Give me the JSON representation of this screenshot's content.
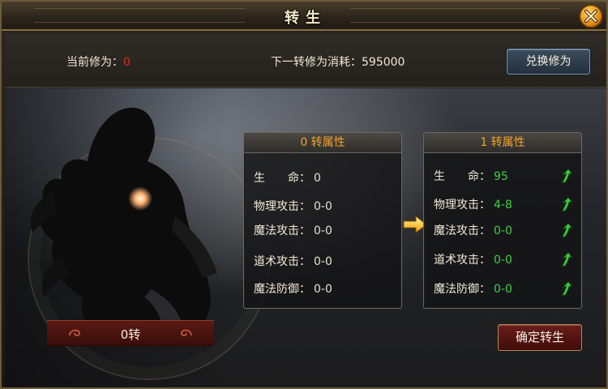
{
  "window": {
    "title": "转生",
    "close_icon": "close-icon"
  },
  "header": {
    "current_label": "当前修为：",
    "current_value": "0",
    "next_cost_label": "下一转修为消耗：",
    "next_cost_value": "595000",
    "exchange_button": "兑换修为"
  },
  "character": {
    "rebirth_level": "0转"
  },
  "current_panel": {
    "title": "0 转属性",
    "stats": [
      {
        "label": "生　　命：",
        "value": "0"
      },
      {
        "label": "物理攻击：",
        "value": "0-0"
      },
      {
        "label": "魔法攻击：",
        "value": "0-0"
      },
      {
        "label": "道术攻击：",
        "value": "0-0"
      },
      {
        "label": "魔法防御：",
        "value": "0-0"
      }
    ]
  },
  "next_panel": {
    "title": "1 转属性",
    "stats": [
      {
        "label": "生　　命：",
        "value": "95"
      },
      {
        "label": "物理攻击：",
        "value": "4-8"
      },
      {
        "label": "魔法攻击：",
        "value": "0-0"
      },
      {
        "label": "道术攻击：",
        "value": "0-0"
      },
      {
        "label": "魔法防御：",
        "value": "0-0"
      }
    ]
  },
  "actions": {
    "confirm_button": "确定转生"
  },
  "colors": {
    "accent_orange": "#f0a22e",
    "increase_green": "#3fd03f",
    "zero_red": "#e02a1c"
  }
}
